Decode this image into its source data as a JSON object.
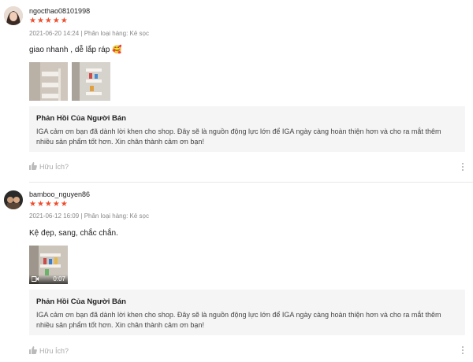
{
  "reviews": [
    {
      "username": "ngocthao08101998",
      "stars": "★★★★★",
      "meta": "2021-06-20 14:24 | Phân loại hàng: Kẻ sọc",
      "comment": "giao nhanh , dễ lắp ráp 🥰",
      "reply_title": "Phản Hồi Của Người Bán",
      "reply_text": "IGA cảm ơn bạn đã dành lời khen cho shop. Đây sẽ là nguồn động lực lớn để IGA ngày càng hoàn thiện hơn và cho ra mắt thêm nhiều sản phẩm tốt hơn. Xin chân thành cảm ơn bạn!",
      "helpful": "Hữu Ích?"
    },
    {
      "username": "bamboo_nguyen86",
      "stars": "★★★★★",
      "meta": "2021-06-12 16:09 | Phân loại hàng: Kẻ sọc",
      "comment": "Kệ đẹp, sang, chắc chắn.",
      "video_duration": "0:07",
      "reply_title": "Phản Hồi Của Người Bán",
      "reply_text": "IGA cảm ơn bạn đã dành lời khen cho shop. Đây sẽ là nguồn động lực lớn để IGA ngày càng hoàn thiện hơn và cho ra mắt thêm nhiều sản phẩm tốt hơn. Xin chân thành cảm ơn bạn!",
      "helpful": "Hữu Ích?"
    }
  ],
  "colors": {
    "star": "#ee4d2d",
    "reply_bg": "#f5f5f5",
    "muted": "#888888"
  },
  "icons": {
    "like": "thumbs-up-icon",
    "more": "more-vertical-icon",
    "video": "video-camera-icon"
  }
}
